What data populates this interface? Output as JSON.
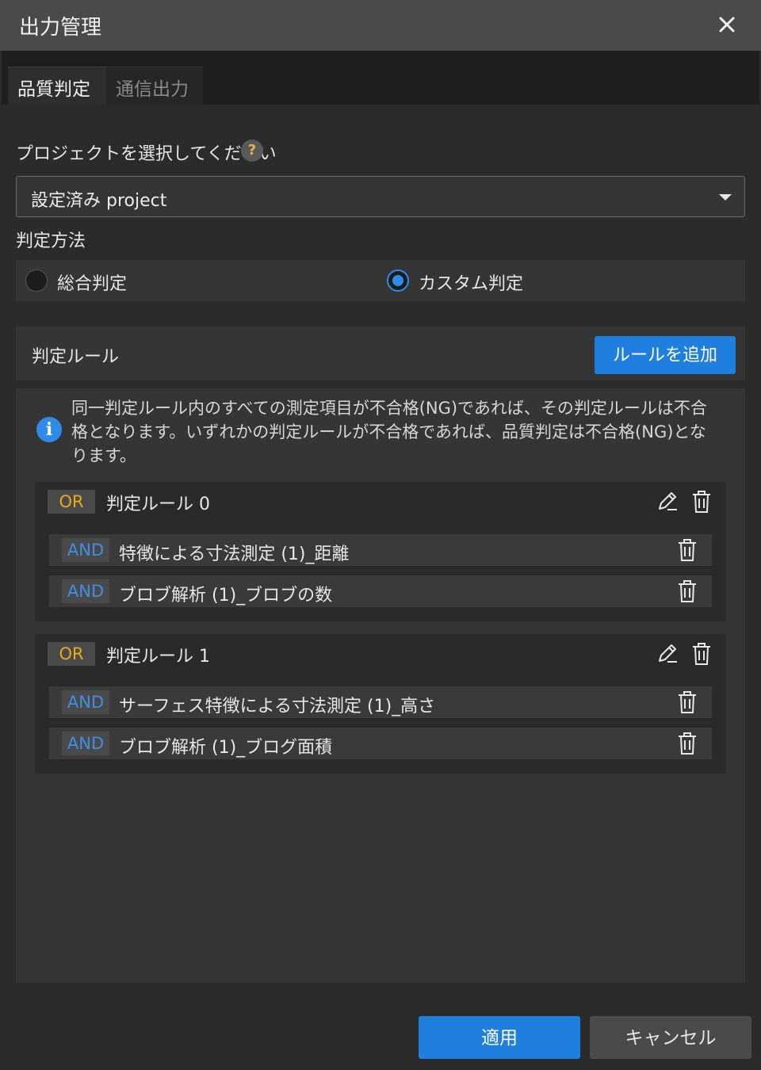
{
  "window": {
    "title": "出力管理"
  },
  "tabs": [
    {
      "label": "品質判定",
      "active": true
    },
    {
      "label": "通信出力",
      "active": false
    }
  ],
  "project": {
    "label": "プロジェクトを選択してください",
    "help": "?",
    "selected": "設定済み project"
  },
  "method": {
    "label": "判定方法",
    "options": [
      {
        "label": "総合判定",
        "selected": false
      },
      {
        "label": "カスタム判定",
        "selected": true
      }
    ]
  },
  "rules": {
    "header_label": "判定ルール",
    "add_button": "ルールを追加",
    "info": "同一判定ルール内のすべての測定項目が不合格(NG)であれば、その判定ルールは不合格となります。いずれかの判定ルールが不合格であれば、品質判定は不合格(NG)となります。",
    "items": [
      {
        "operator": "OR",
        "name": "判定ルール 0",
        "conditions": [
          {
            "operator": "AND",
            "label": "特徴による寸法測定 (1)_距離"
          },
          {
            "operator": "AND",
            "label": "ブロブ解析 (1)_ブロブの数"
          }
        ]
      },
      {
        "operator": "OR",
        "name": "判定ルール 1",
        "conditions": [
          {
            "operator": "AND",
            "label": "サーフェス特徴による寸法測定 (1)_高さ"
          },
          {
            "operator": "AND",
            "label": "ブロブ解析 (1)_ブログ面積"
          }
        ]
      }
    ]
  },
  "footer": {
    "apply": "適用",
    "cancel": "キャンセル"
  },
  "colors": {
    "accent": "#1e7fde",
    "or_badge": "#e8a91b",
    "and_badge": "#3d8fe6"
  }
}
